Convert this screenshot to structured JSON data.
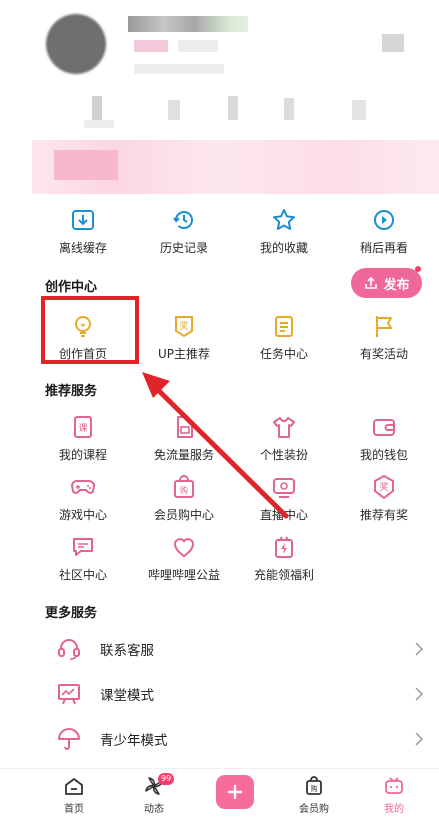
{
  "quick_actions": [
    {
      "label": "离线缓存",
      "icon": "download-icon"
    },
    {
      "label": "历史记录",
      "icon": "history-icon"
    },
    {
      "label": "我的收藏",
      "icon": "star-icon"
    },
    {
      "label": "稍后再看",
      "icon": "play-later-icon"
    }
  ],
  "creation_center": {
    "title": "创作中心",
    "publish_label": "发布",
    "items": [
      {
        "label": "创作首页",
        "icon": "lightbulb-icon"
      },
      {
        "label": "UP主推荐",
        "icon": "award-icon"
      },
      {
        "label": "任务中心",
        "icon": "task-list-icon"
      },
      {
        "label": "有奖活动",
        "icon": "flag-icon"
      }
    ]
  },
  "recommended_services": {
    "title": "推荐服务",
    "items": [
      {
        "label": "我的课程",
        "icon": "course-book-icon"
      },
      {
        "label": "免流量服务",
        "icon": "sim-card-icon"
      },
      {
        "label": "个性装扮",
        "icon": "tshirt-icon"
      },
      {
        "label": "我的钱包",
        "icon": "wallet-icon"
      },
      {
        "label": "游戏中心",
        "icon": "gamepad-icon"
      },
      {
        "label": "会员购中心",
        "icon": "shopping-bag-icon"
      },
      {
        "label": "直播中心",
        "icon": "live-tv-icon"
      },
      {
        "label": "推荐有奖",
        "icon": "reward-badge-icon"
      },
      {
        "label": "社区中心",
        "icon": "chat-bubble-icon"
      },
      {
        "label": "哔哩哔哩公益",
        "icon": "heart-icon"
      },
      {
        "label": "充能领福利",
        "icon": "energy-gift-icon"
      }
    ]
  },
  "more_services": {
    "title": "更多服务",
    "items": [
      {
        "label": "联系客服",
        "icon": "headset-icon"
      },
      {
        "label": "课堂模式",
        "icon": "classroom-icon"
      },
      {
        "label": "青少年模式",
        "icon": "umbrella-icon"
      }
    ]
  },
  "tabbar": {
    "tabs": [
      {
        "label": "首页",
        "icon": "home-icon"
      },
      {
        "label": "动态",
        "icon": "pinwheel-icon",
        "badge": "99"
      },
      {
        "label": "会员购",
        "icon": "shop-icon"
      },
      {
        "label": "我的",
        "icon": "tv-profile-icon"
      }
    ],
    "active_tab": "我的",
    "add_button_icon": "plus-icon"
  },
  "colors": {
    "accent": "#f0679a",
    "icon_blue": "#1c8fcf",
    "icon_gold": "#e6a92b",
    "icon_pink": "#e0668e",
    "highlight_red": "#e0252a"
  }
}
